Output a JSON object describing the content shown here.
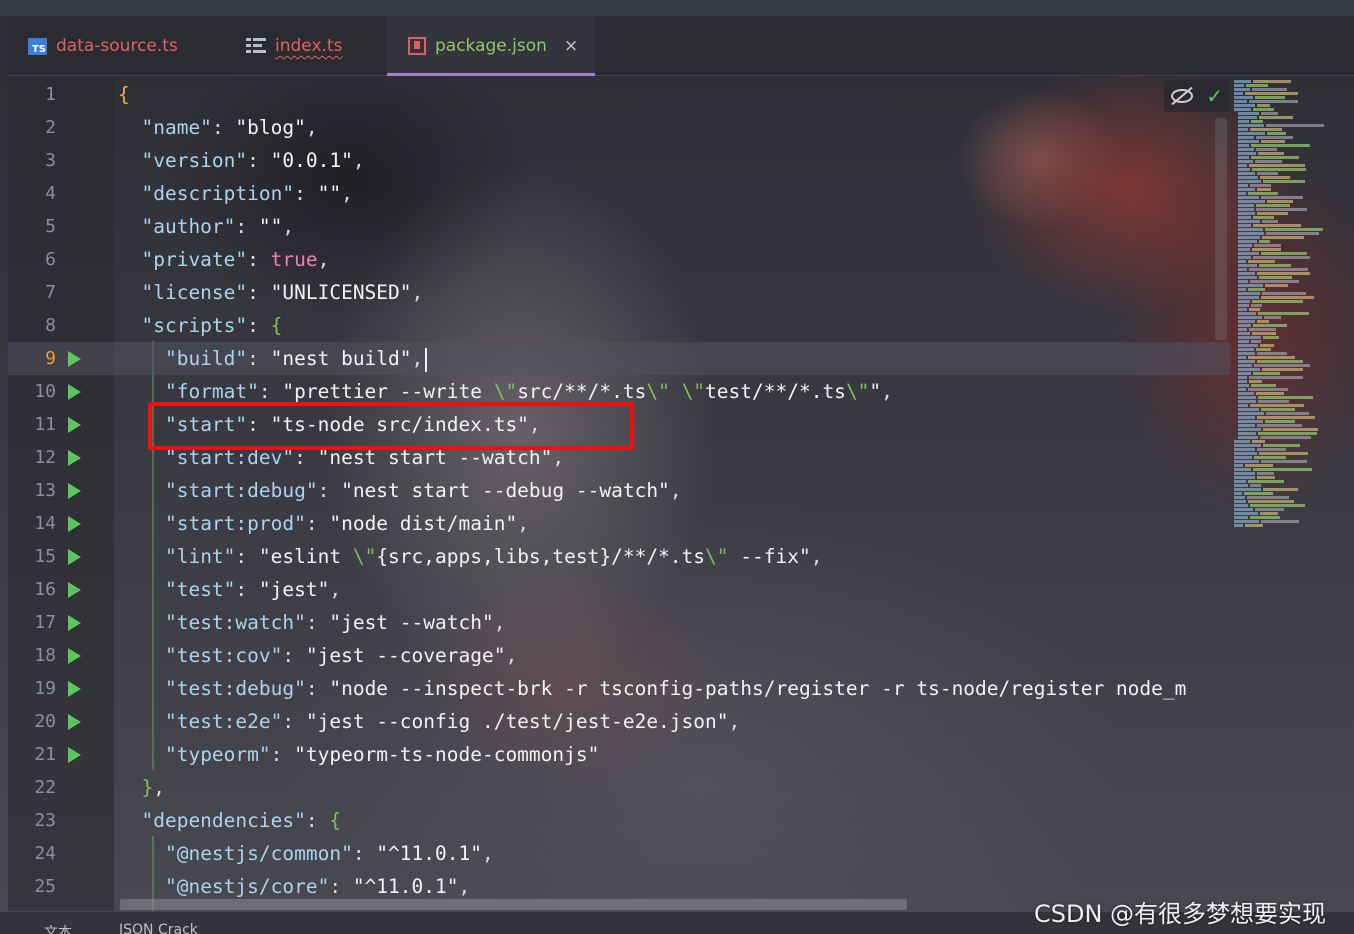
{
  "tabs": [
    {
      "label": "data-source.ts",
      "icon": "typescript-file-icon",
      "active": false
    },
    {
      "label": "index.ts",
      "icon": "structure-icon",
      "active": false
    },
    {
      "label": "package.json",
      "icon": "json-file-icon",
      "active": true,
      "close": "×"
    }
  ],
  "ts_icon_text": "TS",
  "editor": {
    "current_line": 9,
    "lines": [
      {
        "n": "1",
        "run": false
      },
      {
        "n": "2",
        "run": false
      },
      {
        "n": "3",
        "run": false
      },
      {
        "n": "4",
        "run": false
      },
      {
        "n": "5",
        "run": false
      },
      {
        "n": "6",
        "run": false
      },
      {
        "n": "7",
        "run": false
      },
      {
        "n": "8",
        "run": false
      },
      {
        "n": "9",
        "run": true
      },
      {
        "n": "10",
        "run": true
      },
      {
        "n": "11",
        "run": true
      },
      {
        "n": "12",
        "run": true
      },
      {
        "n": "13",
        "run": true
      },
      {
        "n": "14",
        "run": true
      },
      {
        "n": "15",
        "run": true
      },
      {
        "n": "16",
        "run": true
      },
      {
        "n": "17",
        "run": true
      },
      {
        "n": "18",
        "run": true
      },
      {
        "n": "19",
        "run": true
      },
      {
        "n": "20",
        "run": true
      },
      {
        "n": "21",
        "run": true
      },
      {
        "n": "22",
        "run": false
      },
      {
        "n": "23",
        "run": false
      },
      {
        "n": "24",
        "run": false
      },
      {
        "n": "25",
        "run": false
      }
    ],
    "code": [
      [
        {
          "t": "{",
          "c": "b"
        }
      ],
      [
        {
          "t": "  "
        },
        {
          "t": "\"name\"",
          "c": "k"
        },
        {
          "t": ": "
        },
        {
          "t": "\"blog\"",
          "c": "s"
        },
        {
          "t": ","
        }
      ],
      [
        {
          "t": "  "
        },
        {
          "t": "\"version\"",
          "c": "k"
        },
        {
          "t": ": "
        },
        {
          "t": "\"0.0.1\"",
          "c": "s"
        },
        {
          "t": ","
        }
      ],
      [
        {
          "t": "  "
        },
        {
          "t": "\"description\"",
          "c": "k"
        },
        {
          "t": ": "
        },
        {
          "t": "\"\"",
          "c": "s"
        },
        {
          "t": ","
        }
      ],
      [
        {
          "t": "  "
        },
        {
          "t": "\"author\"",
          "c": "k"
        },
        {
          "t": ": "
        },
        {
          "t": "\"\"",
          "c": "s"
        },
        {
          "t": ","
        }
      ],
      [
        {
          "t": "  "
        },
        {
          "t": "\"private\"",
          "c": "k"
        },
        {
          "t": ": "
        },
        {
          "t": "true",
          "c": "kw"
        },
        {
          "t": ","
        }
      ],
      [
        {
          "t": "  "
        },
        {
          "t": "\"license\"",
          "c": "k"
        },
        {
          "t": ": "
        },
        {
          "t": "\"UNLICENSED\"",
          "c": "s"
        },
        {
          "t": ","
        }
      ],
      [
        {
          "t": "  "
        },
        {
          "t": "\"scripts\"",
          "c": "k"
        },
        {
          "t": ": "
        },
        {
          "t": "{",
          "c": "g"
        }
      ],
      [
        {
          "t": "    "
        },
        {
          "t": "\"build\"",
          "c": "k"
        },
        {
          "t": ": "
        },
        {
          "t": "\"nest build\"",
          "c": "s"
        },
        {
          "t": ","
        }
      ],
      [
        {
          "t": "    "
        },
        {
          "t": "\"format\"",
          "c": "k"
        },
        {
          "t": ": "
        },
        {
          "t": "\"prettier --write ",
          "c": "s"
        },
        {
          "t": "\\\"",
          "c": "g"
        },
        {
          "t": "src/**/*.ts",
          "c": "s"
        },
        {
          "t": "\\\"",
          "c": "g"
        },
        {
          "t": " ",
          "c": "s"
        },
        {
          "t": "\\\"",
          "c": "g"
        },
        {
          "t": "test/**/*.ts",
          "c": "s"
        },
        {
          "t": "\\\"",
          "c": "g"
        },
        {
          "t": "\"",
          "c": "s"
        },
        {
          "t": ","
        }
      ],
      [
        {
          "t": "    "
        },
        {
          "t": "\"start\"",
          "c": "k"
        },
        {
          "t": ": "
        },
        {
          "t": "\"ts-node src/index.ts\"",
          "c": "s"
        },
        {
          "t": ","
        }
      ],
      [
        {
          "t": "    "
        },
        {
          "t": "\"start:dev\"",
          "c": "k"
        },
        {
          "t": ": "
        },
        {
          "t": "\"nest start --watch\"",
          "c": "s"
        },
        {
          "t": ","
        }
      ],
      [
        {
          "t": "    "
        },
        {
          "t": "\"start:debug\"",
          "c": "k"
        },
        {
          "t": ": "
        },
        {
          "t": "\"nest start --debug --watch\"",
          "c": "s"
        },
        {
          "t": ","
        }
      ],
      [
        {
          "t": "    "
        },
        {
          "t": "\"start:prod\"",
          "c": "k"
        },
        {
          "t": ": "
        },
        {
          "t": "\"node dist/main\"",
          "c": "s"
        },
        {
          "t": ","
        }
      ],
      [
        {
          "t": "    "
        },
        {
          "t": "\"lint\"",
          "c": "k"
        },
        {
          "t": ": "
        },
        {
          "t": "\"eslint ",
          "c": "s"
        },
        {
          "t": "\\\"",
          "c": "g"
        },
        {
          "t": "{src,apps,libs,test}/**/*.ts",
          "c": "s"
        },
        {
          "t": "\\\"",
          "c": "g"
        },
        {
          "t": " --fix\"",
          "c": "s"
        },
        {
          "t": ","
        }
      ],
      [
        {
          "t": "    "
        },
        {
          "t": "\"test\"",
          "c": "k"
        },
        {
          "t": ": "
        },
        {
          "t": "\"jest\"",
          "c": "s"
        },
        {
          "t": ","
        }
      ],
      [
        {
          "t": "    "
        },
        {
          "t": "\"test:watch\"",
          "c": "k"
        },
        {
          "t": ": "
        },
        {
          "t": "\"jest --watch\"",
          "c": "s"
        },
        {
          "t": ","
        }
      ],
      [
        {
          "t": "    "
        },
        {
          "t": "\"test:cov\"",
          "c": "k"
        },
        {
          "t": ": "
        },
        {
          "t": "\"jest --coverage\"",
          "c": "s"
        },
        {
          "t": ","
        }
      ],
      [
        {
          "t": "    "
        },
        {
          "t": "\"test:debug\"",
          "c": "k"
        },
        {
          "t": ": "
        },
        {
          "t": "\"node --inspect-brk -r tsconfig-paths/register -r ts-node/register node_m",
          "c": "s"
        }
      ],
      [
        {
          "t": "    "
        },
        {
          "t": "\"test:e2e\"",
          "c": "k"
        },
        {
          "t": ": "
        },
        {
          "t": "\"jest --config ./test/jest-e2e.json\"",
          "c": "s"
        },
        {
          "t": ","
        }
      ],
      [
        {
          "t": "    "
        },
        {
          "t": "\"typeorm\"",
          "c": "k"
        },
        {
          "t": ": "
        },
        {
          "t": "\"typeorm-ts-node-commonjs\"",
          "c": "s"
        }
      ],
      [
        {
          "t": "  "
        },
        {
          "t": "}",
          "c": "g"
        },
        {
          "t": ","
        }
      ],
      [
        {
          "t": "  "
        },
        {
          "t": "\"dependencies\"",
          "c": "k"
        },
        {
          "t": ": "
        },
        {
          "t": "{",
          "c": "g"
        }
      ],
      [
        {
          "t": "    "
        },
        {
          "t": "\"@nestjs/common\"",
          "c": "k"
        },
        {
          "t": ": "
        },
        {
          "t": "\"^11.0.1\"",
          "c": "s"
        },
        {
          "t": ","
        }
      ],
      [
        {
          "t": "    "
        },
        {
          "t": "\"@nestjs/core\"",
          "c": "k"
        },
        {
          "t": ": "
        },
        {
          "t": "\"^11.0.1\"",
          "c": "s"
        },
        {
          "t": ","
        }
      ]
    ]
  },
  "status_tabs": [
    "文本",
    "JSON Crack"
  ],
  "watermark": "CSDN @有很多梦想要实现",
  "colors": {
    "key": "#a9d4ee",
    "string": "#f2f2f2",
    "brace": "#e7b14a",
    "boolean": "#e882b2",
    "escape": "#7fbf5f",
    "highlight_box": "#ee1111",
    "run_icon": "#5ac85e",
    "active_tab_underline": "#a87bd9"
  }
}
